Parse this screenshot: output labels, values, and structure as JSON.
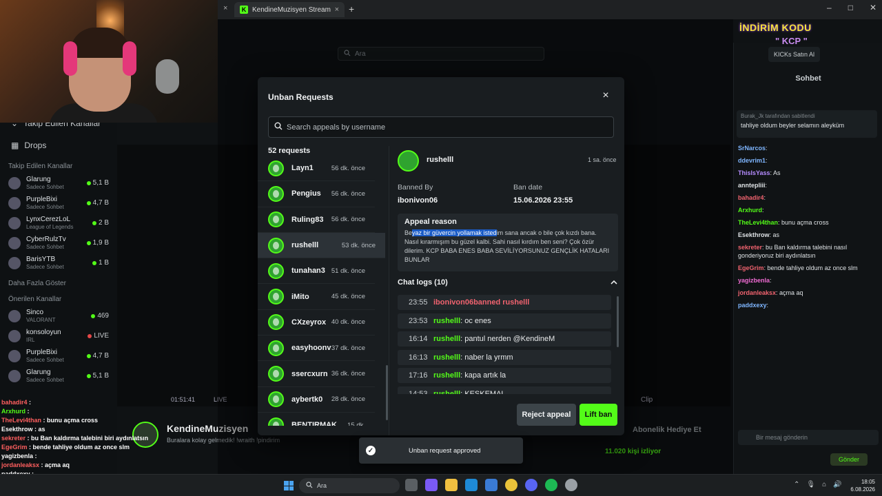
{
  "browser": {
    "tab_title": "KendineMuzisyen Stream - Wa",
    "tab_close": "×",
    "left_tab_close": "×",
    "new_tab": "+",
    "minimize": "–",
    "maximize": "□",
    "close": "✕"
  },
  "top_search": {
    "placeholder": "Ara"
  },
  "left_sidebar": {
    "followed_collapsed": "Takip Edilen Kanallar",
    "drops": "Drops",
    "followed_header": "Takip Edilen Kanallar",
    "followed": [
      {
        "name": "Glarung",
        "sub": "Sadece Sohbet",
        "viewers": "5,1 B",
        "live": true
      },
      {
        "name": "PurpleBixi",
        "sub": "Sadece Sohbet",
        "viewers": "4,7 B",
        "live": true
      },
      {
        "name": "LynxCerezLoL",
        "sub": "League of Legends",
        "viewers": "2 B",
        "live": true
      },
      {
        "name": "CyberRulzTv",
        "sub": "Sadece Sohbet",
        "viewers": "1,9 B",
        "live": true
      },
      {
        "name": "BarisYTB",
        "sub": "Sadece Sohbet",
        "viewers": "1 B",
        "live": true
      }
    ],
    "show_more": "Daha Fazla Göster",
    "recommended_header": "Önerilen Kanallar",
    "recommended": [
      {
        "name": "Sinco",
        "sub": "VALORANT",
        "viewers": "469",
        "live": true
      },
      {
        "name": "konsoloyun",
        "sub": "IRL",
        "viewers": "LIVE",
        "live": false
      },
      {
        "name": "PurpleBixi",
        "sub": "Sadece Sohbet",
        "viewers": "4,7 B",
        "live": true
      },
      {
        "name": "Glarung",
        "sub": "Sadece Sohbet",
        "viewers": "5,1 B",
        "live": true
      }
    ]
  },
  "player": {
    "time": "01:51:41",
    "live": "LIVE",
    "clip": "Clip"
  },
  "stream": {
    "name": "KendineMuzisyen",
    "title": "Buralara kolay gelmedik! !wraith !pindirim",
    "viewers": "11.020 kişi izliyor",
    "sub_btn": "Abonelik Hediye Et"
  },
  "chat": {
    "promo_line1": "İNDİRİM KODU",
    "promo_line2": "\" KCP \"",
    "kicks_btn": "KICKs Satın Al",
    "header": "Sohbet",
    "pinned_by": "Burak_Jk tarafından sabitlendi",
    "pinned_msg": "tahliye oldum beyler selamın aleyküm",
    "messages": [
      {
        "user": "SrNarcos",
        "text": "",
        "color": "#7fb6ff"
      },
      {
        "user": "ddevrim1",
        "text": "",
        "color": "#7fb6ff"
      },
      {
        "user": "ThisIsYass",
        "text": "As",
        "color": "#b58cff"
      },
      {
        "user": "anntepliii",
        "text": "",
        "color": "#dfe3e6"
      },
      {
        "user": "bahadir4",
        "text": "",
        "color": "#f1636f"
      },
      {
        "user": "Arxhurd",
        "text": "",
        "color": "#53fc18"
      },
      {
        "user": "TheLevi4than",
        "text": "bunu açma cross",
        "color": "#53fc18"
      },
      {
        "user": "Esekthrow",
        "text": "as",
        "color": "#dfe3e6"
      },
      {
        "user": "sekreter",
        "text": "bu Ban kaldırma talebini nasıl gonderiyoruz biri aydınlatsın",
        "color": "#f1636f"
      },
      {
        "user": "EgeGrim",
        "text": "bende tahliye oldum az once slm",
        "color": "#f1636f"
      },
      {
        "user": "yagizbenla",
        "text": "",
        "color": "#f06bd3"
      },
      {
        "user": "jordanleaksx",
        "text": "açma aq",
        "color": "#f1636f"
      },
      {
        "user": "paddxexy",
        "text": "",
        "color": "#7fb6ff"
      }
    ],
    "input_placeholder": "Bir mesaj gönderin",
    "send": "Gönder"
  },
  "overlay_chat": [
    {
      "user": "bahadir4",
      "text": "",
      "color": "#ff5f5f"
    },
    {
      "user": "Arxhurd",
      "text": "",
      "color": "#53fc18"
    },
    {
      "user": "TheLevi4than",
      "text": "bunu açma cross",
      "color": "#ff5f5f"
    },
    {
      "user": "Esekthrow",
      "text": "as",
      "color": "#ffffff"
    },
    {
      "user": "sekreter",
      "text": "bu Ban kaldırma talebini biri aydınlatsın",
      "color": "#ff5f5f"
    },
    {
      "user": "EgeGrim",
      "text": "bende tahliye oldum az once slm",
      "color": "#ff5f5f"
    },
    {
      "user": "yagizbenla",
      "text": "",
      "color": "#ffffff"
    },
    {
      "user": "jordanleaksx",
      "text": "açma aq",
      "color": "#ff5f5f"
    },
    {
      "user": "paddxexy",
      "text": "",
      "color": "#ffffff"
    }
  ],
  "modal": {
    "title": "Unban Requests",
    "close": "×",
    "search_placeholder": "Search appeals by username",
    "count": "52 requests",
    "requests": [
      {
        "user": "Layn1",
        "time": "56 dk. önce"
      },
      {
        "user": "Pengius",
        "time": "56 dk. önce"
      },
      {
        "user": "Ruling83",
        "time": "56 dk. önce"
      },
      {
        "user": "rushelll",
        "time": "53 dk. önce",
        "selected": true
      },
      {
        "user": "tunahan3",
        "time": "51 dk. önce"
      },
      {
        "user": "iMito",
        "time": "45 dk. önce"
      },
      {
        "user": "CXzeyrox",
        "time": "40 dk. önce"
      },
      {
        "user": "easyhoonv",
        "time": "37 dk. önce"
      },
      {
        "user": "ssercxurn",
        "time": "36 dk. önce"
      },
      {
        "user": "aybertk0",
        "time": "28 dk. önce"
      },
      {
        "user": "BENTIRMAK",
        "time": "15 dk."
      }
    ],
    "detail": {
      "user": "rushelll",
      "time": "1 sa. önce",
      "banned_by_label": "Banned By",
      "banned_by": "ibonivon06",
      "ban_date_label": "Ban date",
      "ban_date": "15.06.2026 23:55",
      "appeal_label": "Appeal reason",
      "appeal_pre": "Be",
      "appeal_highlight": "yaz bir güvercin yollamak isted",
      "appeal_post": "im sana ancak o bile çok kızdı bana. Nasıl kırarmışım bu güzel kalbi. Sahi nasıl kırdım ben seni? Çok özür dilerim. KCP BABA ENES BABA SEVİLİYORSUNUZ GENÇLİK HATALARI BUNLAR",
      "chat_logs_label": "Chat logs (10)",
      "logs": [
        {
          "time": "23:55",
          "user": "ibonivon06",
          "msg": " banned rushelll",
          "ban": true
        },
        {
          "time": "23:53",
          "user": "rushelll",
          "msg": ": oc enes"
        },
        {
          "time": "16:14",
          "user": "rushelll",
          "msg": ": pantul nerden @KendineM"
        },
        {
          "time": "16:13",
          "user": "rushelll",
          "msg": ": naber la yrmm"
        },
        {
          "time": "17:16",
          "user": "rushelll",
          "msg": ": kapa artık la"
        },
        {
          "time": "14:53",
          "user": "rushelll",
          "msg": ": KESKEMAL"
        }
      ]
    },
    "reject": "Reject appeal",
    "lift": "Lift ban"
  },
  "toast": {
    "text": "Unban request approved",
    "check": "✓"
  },
  "taskbar": {
    "search": "Ara",
    "time": "18:05",
    "date": "6.08.2026"
  }
}
